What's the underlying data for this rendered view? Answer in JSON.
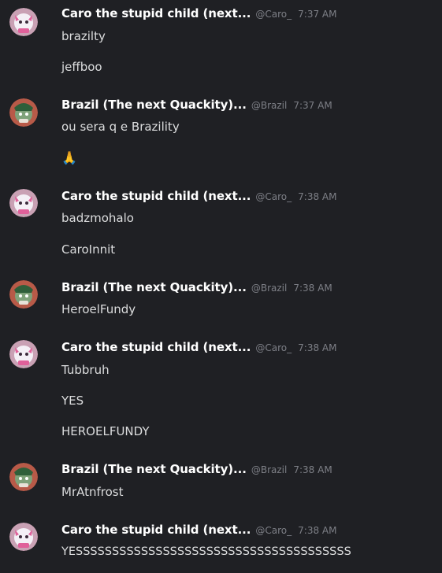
{
  "users": {
    "caro": {
      "name": "Caro the stupid child (next...",
      "handle": "@Caro_"
    },
    "brazil": {
      "name": "Brazil (The next Quackity)...",
      "handle": "@Brazil"
    }
  },
  "messages": [
    {
      "user": "caro",
      "time": "7:37 AM",
      "lines": [
        "brazilty",
        "jeffboo"
      ]
    },
    {
      "user": "brazil",
      "time": "7:37 AM",
      "lines": [
        "ou sera q e Brazility",
        "🙏"
      ]
    },
    {
      "user": "caro",
      "time": "7:38 AM",
      "lines": [
        "badzmohalo",
        "CaroInnit"
      ]
    },
    {
      "user": "brazil",
      "time": "7:38 AM",
      "lines": [
        "HeroelFundy"
      ]
    },
    {
      "user": "caro",
      "time": "7:38 AM",
      "lines": [
        "Tubbruh",
        "YES",
        "HEROELFUNDY"
      ]
    },
    {
      "user": "brazil",
      "time": "7:38 AM",
      "lines": [
        "MrAtnfrost"
      ]
    },
    {
      "user": "caro",
      "time": "7:38 AM",
      "lines": [
        "YESSSSSSSSSSSSSSSSSSSSSSSSSSSSSSSSSSSSSS"
      ]
    }
  ],
  "colors": {
    "background": "#1f2024",
    "username": "#ffffff",
    "meta": "#7d7f86",
    "text": "#dcddde"
  },
  "icons": {
    "caro_avatar": "pink-white-character-avatar",
    "brazil_avatar": "green-character-avatar"
  }
}
